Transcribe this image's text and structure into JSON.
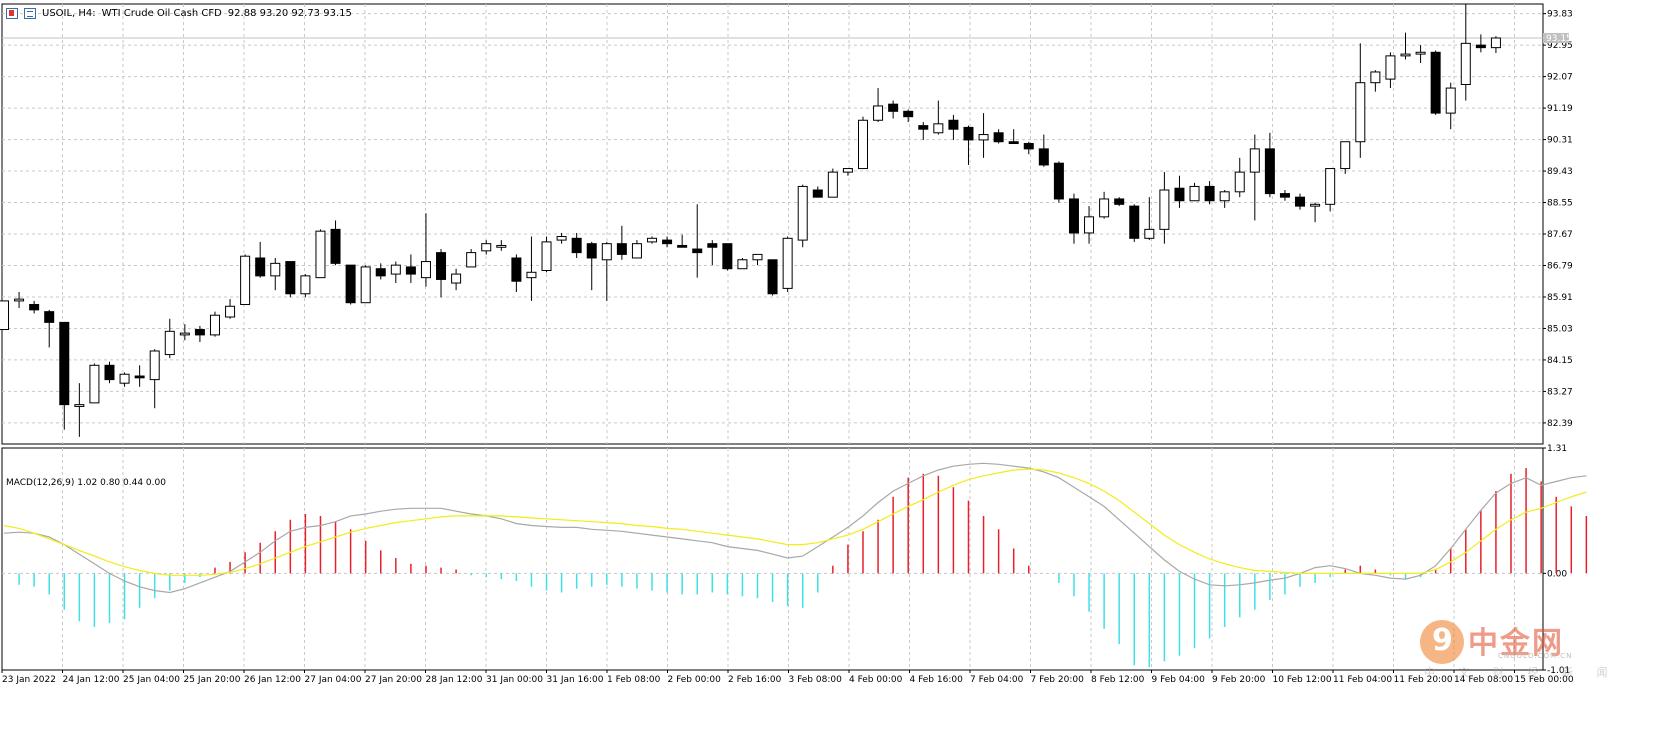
{
  "header": {
    "symbol": "USOIL, H4:",
    "description": "WTI Crude Oil Cash CFD",
    "ohlc": "92.88 93.20 92.73 93.15",
    "icons": [
      "chart-window-icon",
      "trade-window-icon"
    ]
  },
  "macd_label": "MACD(12,26,9) 1.02 0.80 0.44 0.00",
  "watermark": {
    "brand": "中金网",
    "domain": "CNGOLD.COM.CN",
    "tagline": "中 文 财 经 新 闻"
  },
  "colors": {
    "grid": "#c8c8c8",
    "candle_up": "#ffffff",
    "candle_down": "#000000",
    "hist_pos": "#e8202a",
    "hist_neg": "#3fe0e6",
    "macd_line": "#a8a8a8",
    "signal_line": "#f2ec17",
    "current_price_line": "#c0c0c0"
  },
  "chart_data": [
    {
      "type": "candlestick",
      "title": "USOIL, H4: WTI Crude Oil Cash CFD",
      "ylim": [
        81.8,
        94.1
      ],
      "y_ticks": [
        "93.83",
        "92.95",
        "92.07",
        "91.19",
        "90.31",
        "89.43",
        "88.55",
        "87.67",
        "86.79",
        "85.91",
        "85.03",
        "84.15",
        "83.27",
        "82.39"
      ],
      "y_tick_values": [
        93.83,
        92.95,
        92.07,
        91.19,
        90.31,
        89.43,
        88.55,
        87.67,
        86.79,
        85.91,
        85.03,
        84.15,
        83.27,
        82.39
      ],
      "current_price": 93.15,
      "current_price_label": "93.15",
      "x_labels": [
        "23 Jan 2022",
        "24 Jan 12:00",
        "25 Jan 04:00",
        "25 Jan 20:00",
        "26 Jan 12:00",
        "27 Jan 04:00",
        "27 Jan 20:00",
        "28 Jan 12:00",
        "31 Jan 00:00",
        "31 Jan 16:00",
        "1 Feb 08:00",
        "2 Feb 00:00",
        "2 Feb 16:00",
        "3 Feb 08:00",
        "4 Feb 00:00",
        "4 Feb 16:00",
        "7 Feb 04:00",
        "7 Feb 20:00",
        "8 Feb 12:00",
        "9 Feb 04:00",
        "9 Feb 20:00",
        "10 Feb 12:00",
        "11 Feb 04:00",
        "11 Feb 20:00",
        "14 Feb 08:00",
        "15 Feb 00:00"
      ],
      "candles": [
        {
          "o": 85.0,
          "h": 85.6,
          "l": 85.0,
          "c": 85.8
        },
        {
          "o": 85.8,
          "h": 86.05,
          "l": 85.6,
          "c": 85.85
        },
        {
          "o": 85.7,
          "h": 85.8,
          "l": 85.45,
          "c": 85.55
        },
        {
          "o": 85.5,
          "h": 85.55,
          "l": 84.5,
          "c": 85.2
        },
        {
          "o": 85.2,
          "h": 85.2,
          "l": 82.2,
          "c": 82.9
        },
        {
          "o": 82.85,
          "h": 83.5,
          "l": 82.0,
          "c": 82.9
        },
        {
          "o": 82.95,
          "h": 84.05,
          "l": 82.95,
          "c": 84.0
        },
        {
          "o": 84.0,
          "h": 84.1,
          "l": 83.5,
          "c": 83.6
        },
        {
          "o": 83.5,
          "h": 83.8,
          "l": 83.4,
          "c": 83.75
        },
        {
          "o": 83.7,
          "h": 84.0,
          "l": 83.4,
          "c": 83.65
        },
        {
          "o": 83.6,
          "h": 84.45,
          "l": 82.8,
          "c": 84.4
        },
        {
          "o": 84.3,
          "h": 85.3,
          "l": 84.2,
          "c": 84.95
        },
        {
          "o": 84.85,
          "h": 85.15,
          "l": 84.7,
          "c": 84.9
        },
        {
          "o": 85.0,
          "h": 85.1,
          "l": 84.65,
          "c": 84.85
        },
        {
          "o": 84.85,
          "h": 85.5,
          "l": 84.8,
          "c": 85.4
        },
        {
          "o": 85.35,
          "h": 85.85,
          "l": 85.3,
          "c": 85.65
        },
        {
          "o": 85.7,
          "h": 87.1,
          "l": 85.7,
          "c": 87.05
        },
        {
          "o": 87.0,
          "h": 87.45,
          "l": 86.45,
          "c": 86.5
        },
        {
          "o": 86.5,
          "h": 87.0,
          "l": 86.1,
          "c": 86.85
        },
        {
          "o": 86.9,
          "h": 86.9,
          "l": 85.9,
          "c": 86.0
        },
        {
          "o": 86.0,
          "h": 86.55,
          "l": 85.9,
          "c": 86.5
        },
        {
          "o": 86.45,
          "h": 87.8,
          "l": 86.45,
          "c": 87.75
        },
        {
          "o": 87.8,
          "h": 88.05,
          "l": 86.8,
          "c": 86.85
        },
        {
          "o": 86.8,
          "h": 86.8,
          "l": 85.7,
          "c": 85.75
        },
        {
          "o": 85.75,
          "h": 86.8,
          "l": 85.75,
          "c": 86.75
        },
        {
          "o": 86.7,
          "h": 86.85,
          "l": 86.4,
          "c": 86.5
        },
        {
          "o": 86.55,
          "h": 86.9,
          "l": 86.3,
          "c": 86.8
        },
        {
          "o": 86.75,
          "h": 87.1,
          "l": 86.3,
          "c": 86.55
        },
        {
          "o": 86.45,
          "h": 88.25,
          "l": 86.2,
          "c": 86.9
        },
        {
          "o": 87.15,
          "h": 87.25,
          "l": 85.9,
          "c": 86.4
        },
        {
          "o": 86.3,
          "h": 86.7,
          "l": 86.1,
          "c": 86.55
        },
        {
          "o": 86.75,
          "h": 87.25,
          "l": 86.75,
          "c": 87.15
        },
        {
          "o": 87.2,
          "h": 87.5,
          "l": 87.1,
          "c": 87.4
        },
        {
          "o": 87.3,
          "h": 87.5,
          "l": 87.2,
          "c": 87.35
        },
        {
          "o": 87.0,
          "h": 87.1,
          "l": 86.05,
          "c": 86.35
        },
        {
          "o": 86.45,
          "h": 87.6,
          "l": 85.8,
          "c": 86.6
        },
        {
          "o": 86.65,
          "h": 87.6,
          "l": 86.6,
          "c": 87.45
        },
        {
          "o": 87.5,
          "h": 87.7,
          "l": 87.4,
          "c": 87.6
        },
        {
          "o": 87.55,
          "h": 87.7,
          "l": 87.0,
          "c": 87.15
        },
        {
          "o": 87.4,
          "h": 87.45,
          "l": 86.1,
          "c": 87.0
        },
        {
          "o": 86.95,
          "h": 87.45,
          "l": 85.8,
          "c": 87.4
        },
        {
          "o": 87.4,
          "h": 87.9,
          "l": 86.95,
          "c": 87.1
        },
        {
          "o": 87.0,
          "h": 87.5,
          "l": 87.0,
          "c": 87.4
        },
        {
          "o": 87.45,
          "h": 87.6,
          "l": 87.4,
          "c": 87.55
        },
        {
          "o": 87.5,
          "h": 87.6,
          "l": 87.3,
          "c": 87.4
        },
        {
          "o": 87.35,
          "h": 87.65,
          "l": 87.3,
          "c": 87.3
        },
        {
          "o": 87.25,
          "h": 88.5,
          "l": 86.45,
          "c": 87.15
        },
        {
          "o": 87.4,
          "h": 87.5,
          "l": 86.8,
          "c": 87.3
        },
        {
          "o": 87.4,
          "h": 87.4,
          "l": 86.65,
          "c": 86.7
        },
        {
          "o": 86.7,
          "h": 87.0,
          "l": 86.7,
          "c": 86.95
        },
        {
          "o": 86.95,
          "h": 87.1,
          "l": 86.8,
          "c": 87.1
        },
        {
          "o": 86.95,
          "h": 86.95,
          "l": 85.95,
          "c": 86.0
        },
        {
          "o": 86.15,
          "h": 87.6,
          "l": 86.05,
          "c": 87.55
        },
        {
          "o": 87.5,
          "h": 89.05,
          "l": 87.3,
          "c": 89.0
        },
        {
          "o": 88.9,
          "h": 89.0,
          "l": 88.85,
          "c": 88.7
        },
        {
          "o": 88.7,
          "h": 89.5,
          "l": 88.7,
          "c": 89.4
        },
        {
          "o": 89.4,
          "h": 89.5,
          "l": 89.3,
          "c": 89.5
        },
        {
          "o": 89.5,
          "h": 90.95,
          "l": 89.5,
          "c": 90.85
        },
        {
          "o": 90.85,
          "h": 91.75,
          "l": 90.8,
          "c": 91.25
        },
        {
          "o": 91.3,
          "h": 91.4,
          "l": 90.9,
          "c": 91.1
        },
        {
          "o": 91.1,
          "h": 91.15,
          "l": 90.8,
          "c": 90.95
        },
        {
          "o": 90.7,
          "h": 90.8,
          "l": 90.3,
          "c": 90.6
        },
        {
          "o": 90.5,
          "h": 91.4,
          "l": 90.45,
          "c": 90.75
        },
        {
          "o": 90.85,
          "h": 91.0,
          "l": 90.3,
          "c": 90.6
        },
        {
          "o": 90.65,
          "h": 90.7,
          "l": 89.6,
          "c": 90.3
        },
        {
          "o": 90.3,
          "h": 91.05,
          "l": 89.8,
          "c": 90.45
        },
        {
          "o": 90.5,
          "h": 90.6,
          "l": 90.2,
          "c": 90.25
        },
        {
          "o": 90.25,
          "h": 90.6,
          "l": 90.2,
          "c": 90.2
        },
        {
          "o": 90.2,
          "h": 90.25,
          "l": 89.9,
          "c": 90.05
        },
        {
          "o": 90.05,
          "h": 90.45,
          "l": 89.55,
          "c": 89.6
        },
        {
          "o": 89.65,
          "h": 89.7,
          "l": 88.55,
          "c": 88.65
        },
        {
          "o": 88.65,
          "h": 88.8,
          "l": 87.4,
          "c": 87.7
        },
        {
          "o": 87.7,
          "h": 88.45,
          "l": 87.4,
          "c": 88.15
        },
        {
          "o": 88.15,
          "h": 88.85,
          "l": 88.1,
          "c": 88.65
        },
        {
          "o": 88.65,
          "h": 88.7,
          "l": 88.45,
          "c": 88.5
        },
        {
          "o": 88.45,
          "h": 88.5,
          "l": 87.45,
          "c": 87.55
        },
        {
          "o": 87.55,
          "h": 88.7,
          "l": 87.5,
          "c": 87.8
        },
        {
          "o": 87.8,
          "h": 89.4,
          "l": 87.4,
          "c": 88.9
        },
        {
          "o": 88.95,
          "h": 89.3,
          "l": 88.4,
          "c": 88.6
        },
        {
          "o": 88.6,
          "h": 89.1,
          "l": 88.6,
          "c": 89.0
        },
        {
          "o": 89.0,
          "h": 89.15,
          "l": 88.5,
          "c": 88.6
        },
        {
          "o": 88.6,
          "h": 88.9,
          "l": 88.4,
          "c": 88.85
        },
        {
          "o": 88.85,
          "h": 89.8,
          "l": 88.7,
          "c": 89.4
        },
        {
          "o": 89.4,
          "h": 90.45,
          "l": 88.05,
          "c": 90.05
        },
        {
          "o": 90.05,
          "h": 90.5,
          "l": 88.7,
          "c": 88.8
        },
        {
          "o": 88.8,
          "h": 88.9,
          "l": 88.6,
          "c": 88.7
        },
        {
          "o": 88.7,
          "h": 88.8,
          "l": 88.35,
          "c": 88.45
        },
        {
          "o": 88.45,
          "h": 88.55,
          "l": 88.0,
          "c": 88.5
        },
        {
          "o": 88.5,
          "h": 89.5,
          "l": 88.3,
          "c": 89.5
        },
        {
          "o": 89.5,
          "h": 90.25,
          "l": 89.35,
          "c": 90.25
        },
        {
          "o": 90.25,
          "h": 93.0,
          "l": 89.8,
          "c": 91.9
        },
        {
          "o": 91.9,
          "h": 92.25,
          "l": 91.65,
          "c": 92.2
        },
        {
          "o": 92.0,
          "h": 92.75,
          "l": 91.75,
          "c": 92.65
        },
        {
          "o": 92.65,
          "h": 93.3,
          "l": 92.55,
          "c": 92.7
        },
        {
          "o": 92.7,
          "h": 92.95,
          "l": 92.45,
          "c": 92.75
        },
        {
          "o": 92.75,
          "h": 92.8,
          "l": 91.0,
          "c": 91.05
        },
        {
          "o": 91.05,
          "h": 91.9,
          "l": 90.6,
          "c": 91.75
        },
        {
          "o": 91.85,
          "h": 94.1,
          "l": 91.4,
          "c": 93.0
        },
        {
          "o": 92.95,
          "h": 93.25,
          "l": 92.75,
          "c": 92.88
        },
        {
          "o": 92.88,
          "h": 93.2,
          "l": 92.73,
          "c": 93.15
        }
      ]
    },
    {
      "type": "macd",
      "title": "MACD(12,26,9) 1.02 0.80 0.44 0.00",
      "ylim": [
        -1.01,
        1.31
      ],
      "y_tick_labels": [
        "1.31",
        "0.00",
        "-1.01"
      ],
      "y_tick_values": [
        1.31,
        0.0,
        -1.01
      ],
      "main_line": [
        0.42,
        0.43,
        0.42,
        0.38,
        0.3,
        0.2,
        0.1,
        0.0,
        -0.08,
        -0.14,
        -0.18,
        -0.2,
        -0.16,
        -0.1,
        -0.04,
        0.02,
        0.12,
        0.22,
        0.34,
        0.44,
        0.48,
        0.5,
        0.54,
        0.6,
        0.62,
        0.65,
        0.67,
        0.68,
        0.68,
        0.68,
        0.65,
        0.62,
        0.6,
        0.57,
        0.52,
        0.5,
        0.49,
        0.48,
        0.48,
        0.46,
        0.45,
        0.44,
        0.42,
        0.4,
        0.38,
        0.36,
        0.34,
        0.32,
        0.28,
        0.26,
        0.24,
        0.2,
        0.16,
        0.18,
        0.28,
        0.38,
        0.48,
        0.6,
        0.74,
        0.86,
        0.94,
        1.02,
        1.08,
        1.12,
        1.14,
        1.15,
        1.14,
        1.12,
        1.1,
        1.06,
        1.0,
        0.9,
        0.8,
        0.7,
        0.56,
        0.42,
        0.28,
        0.14,
        0.02,
        -0.06,
        -0.12,
        -0.13,
        -0.12,
        -0.1,
        -0.07,
        -0.05,
        0.0,
        0.06,
        0.08,
        0.05,
        0.0,
        -0.02,
        -0.05,
        -0.06,
        -0.02,
        0.08,
        0.26,
        0.46,
        0.66,
        0.84,
        0.94,
        1.0,
        0.92,
        0.96,
        1.0,
        1.02
      ],
      "signal_line": [
        0.5,
        0.47,
        0.42,
        0.36,
        0.3,
        0.24,
        0.18,
        0.12,
        0.07,
        0.03,
        0.0,
        -0.02,
        -0.02,
        -0.02,
        -0.01,
        0.01,
        0.05,
        0.1,
        0.16,
        0.22,
        0.28,
        0.33,
        0.38,
        0.43,
        0.47,
        0.5,
        0.53,
        0.55,
        0.57,
        0.59,
        0.6,
        0.6,
        0.6,
        0.6,
        0.59,
        0.58,
        0.57,
        0.56,
        0.55,
        0.54,
        0.53,
        0.52,
        0.5,
        0.49,
        0.47,
        0.46,
        0.44,
        0.42,
        0.4,
        0.38,
        0.36,
        0.33,
        0.3,
        0.3,
        0.32,
        0.36,
        0.4,
        0.46,
        0.54,
        0.62,
        0.7,
        0.77,
        0.85,
        0.92,
        0.98,
        1.02,
        1.05,
        1.08,
        1.09,
        1.08,
        1.05,
        1.0,
        0.94,
        0.86,
        0.76,
        0.64,
        0.52,
        0.4,
        0.3,
        0.22,
        0.15,
        0.1,
        0.06,
        0.03,
        0.02,
        0.01,
        0.0,
        0.0,
        0.0,
        0.0,
        0.0,
        0.0,
        0.0,
        0.0,
        0.0,
        0.04,
        0.12,
        0.22,
        0.34,
        0.46,
        0.56,
        0.64,
        0.68,
        0.74,
        0.8,
        0.85
      ],
      "histogram": [
        0.0,
        -0.12,
        -0.14,
        -0.22,
        -0.38,
        -0.5,
        -0.56,
        -0.52,
        -0.48,
        -0.36,
        -0.26,
        -0.18,
        -0.1,
        -0.04,
        0.06,
        0.12,
        0.22,
        0.32,
        0.44,
        0.56,
        0.62,
        0.6,
        0.54,
        0.46,
        0.34,
        0.24,
        0.16,
        0.1,
        0.08,
        0.06,
        0.04,
        -0.02,
        -0.04,
        -0.06,
        -0.08,
        -0.14,
        -0.18,
        -0.2,
        -0.16,
        -0.14,
        -0.12,
        -0.14,
        -0.16,
        -0.18,
        -0.2,
        -0.22,
        -0.22,
        -0.2,
        -0.22,
        -0.24,
        -0.26,
        -0.3,
        -0.34,
        -0.36,
        -0.2,
        0.08,
        0.3,
        0.44,
        0.56,
        0.8,
        1.0,
        1.04,
        1.02,
        0.9,
        0.76,
        0.6,
        0.46,
        0.26,
        0.08,
        0.0,
        -0.1,
        -0.24,
        -0.4,
        -0.58,
        -0.74,
        -0.96,
        -0.98,
        -0.92,
        -0.86,
        -0.78,
        -0.68,
        -0.56,
        -0.46,
        -0.38,
        -0.28,
        -0.22,
        -0.14,
        -0.1,
        -0.04,
        0.04,
        0.08,
        0.04,
        -0.02,
        -0.06,
        -0.04,
        0.04,
        0.26,
        0.46,
        0.66,
        0.86,
        1.04,
        1.1,
        0.96,
        0.8,
        0.7,
        0.6
      ]
    }
  ]
}
